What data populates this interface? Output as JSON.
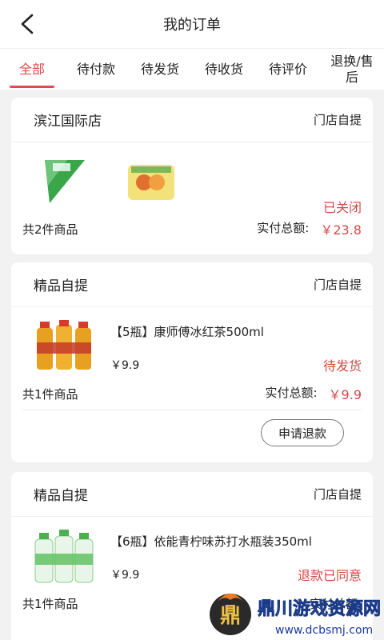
{
  "header": {
    "title": "我的订单",
    "back_icon": "chevron-left-icon"
  },
  "tabs": [
    {
      "label": "全部",
      "active": true
    },
    {
      "label": "待付款"
    },
    {
      "label": "待发货"
    },
    {
      "label": "待收货"
    },
    {
      "label": "待评价"
    },
    {
      "label": "退换/售后"
    }
  ],
  "orders": [
    {
      "store": "滨江国际店",
      "pickup": "门店自提",
      "status": "已关闭",
      "count_text": "共2件商品",
      "total_label": "实付总额:",
      "total_value": "￥23.8"
    },
    {
      "store": "精品自提",
      "pickup": "门店自提",
      "product_name": "【5瓶】康师傅冰红茶500ml",
      "product_price": "￥9.9",
      "status": "待发货",
      "count_text": "共1件商品",
      "total_label": "实付总额:",
      "total_value": "￥9.9",
      "button": "申请退款"
    },
    {
      "store": "精品自提",
      "pickup": "门店自提",
      "product_name": "【6瓶】依能青柠味苏打水瓶装350ml",
      "product_price": "￥9.9",
      "status": "退款已同意",
      "count_text": "共1件商品",
      "total_label": "实付总额:"
    }
  ],
  "watermark": {
    "brand": "鼎川游戏资源网",
    "url": "www.dcbsmj.com"
  },
  "colors": {
    "accent": "#e14a4a",
    "status": "#d04a4a",
    "background": "#f2f2f2"
  }
}
